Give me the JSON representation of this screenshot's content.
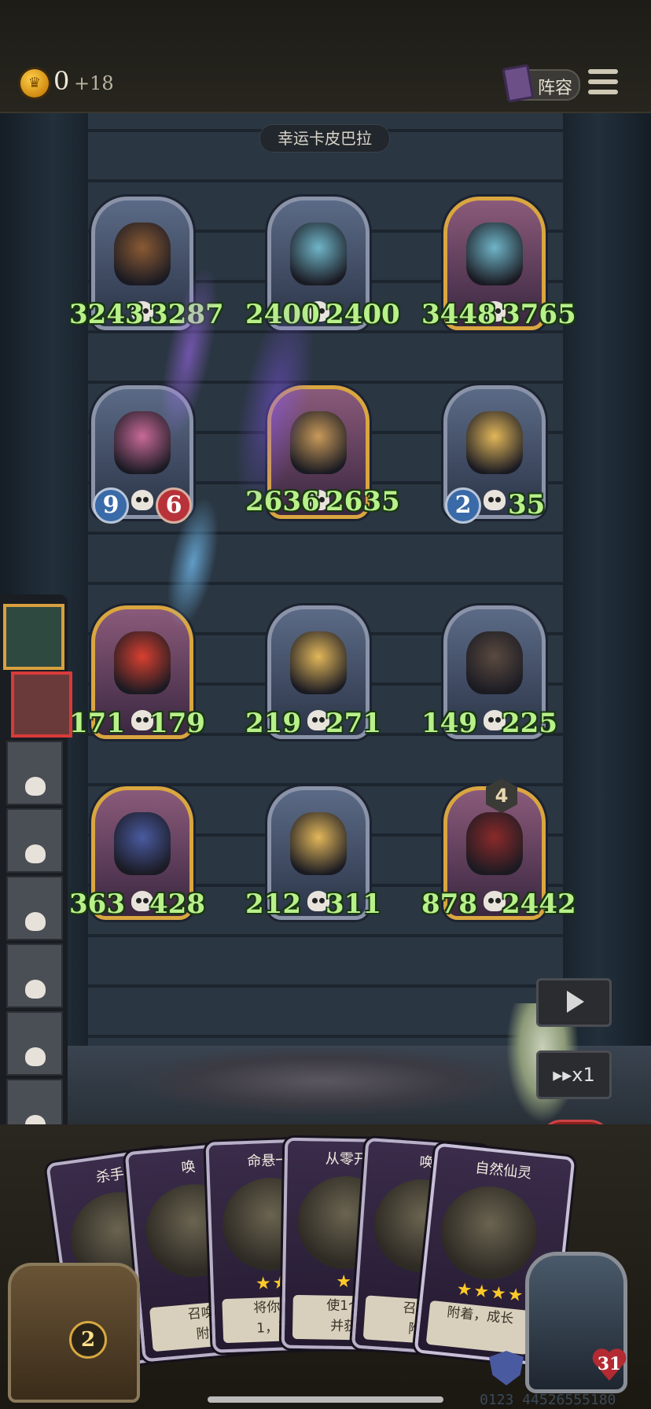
{
  "header": {
    "coins": "0",
    "coin_bonus": "+18",
    "lineup_label": "阵容",
    "stage_title": "幸运卡皮巴拉"
  },
  "board": {
    "units": [
      {
        "attack": "3243",
        "health": "3287",
        "frame": "silver",
        "art_color": "#8a5a34"
      },
      {
        "attack": "2400",
        "health": "2400",
        "frame": "silver",
        "art_color": "#6fb5c8"
      },
      {
        "attack": "3448",
        "health": "3765",
        "frame": "gold",
        "art_color": "#6fb5c8"
      },
      {
        "attack": "9",
        "health": "6",
        "frame": "silver",
        "art_color": "#c86a98",
        "badge_style": true
      },
      {
        "attack": "2636",
        "health": "2635",
        "frame": "gold",
        "art_color": "#c89a5a"
      },
      {
        "attack": "2",
        "health": "35",
        "frame": "silver",
        "art_color": "#e2b75a",
        "badge_style": true
      },
      {
        "attack": "171",
        "health": "179",
        "frame": "gold",
        "art_color": "#d84030"
      },
      {
        "attack": "219",
        "health": "271",
        "frame": "silver",
        "art_color": "#e2b75a"
      },
      {
        "attack": "149",
        "health": "225",
        "frame": "silver",
        "art_color": "#5a4a40"
      },
      {
        "attack": "363",
        "health": "428",
        "frame": "gold",
        "art_color": "#4a5aa0"
      },
      {
        "attack": "212",
        "health": "311",
        "frame": "silver",
        "art_color": "#e2b75a"
      },
      {
        "attack": "878",
        "health": "2442",
        "frame": "gold",
        "art_color": "#8a2a2a"
      }
    ],
    "level_badge": "4"
  },
  "controls": {
    "speed_label": "▸▸x1"
  },
  "hand": {
    "cards": [
      {
        "title": "杀手",
        "stars": "",
        "desc": ""
      },
      {
        "title": "唤",
        "stars": "",
        "desc": "召唤\n附"
      },
      {
        "title": "命悬一",
        "stars": "★★",
        "desc": "将你的\n1，获"
      },
      {
        "title": "从零开",
        "stars": "★",
        "desc": "使1个\n并获"
      },
      {
        "title": "唤",
        "stars": "",
        "desc": "召唤\n附"
      },
      {
        "title": "自然仙灵",
        "stars": "★★★★",
        "desc": "附着，成长"
      }
    ],
    "chest_count": "2",
    "hero_hp": "31"
  },
  "footer": {
    "debug_text": "0123 44526555180"
  },
  "colors": {
    "stat_text": "#b8f08a",
    "gold_frame": "#d9a640",
    "silver_frame": "#8a93a8",
    "alert_red": "#d83a3a"
  }
}
